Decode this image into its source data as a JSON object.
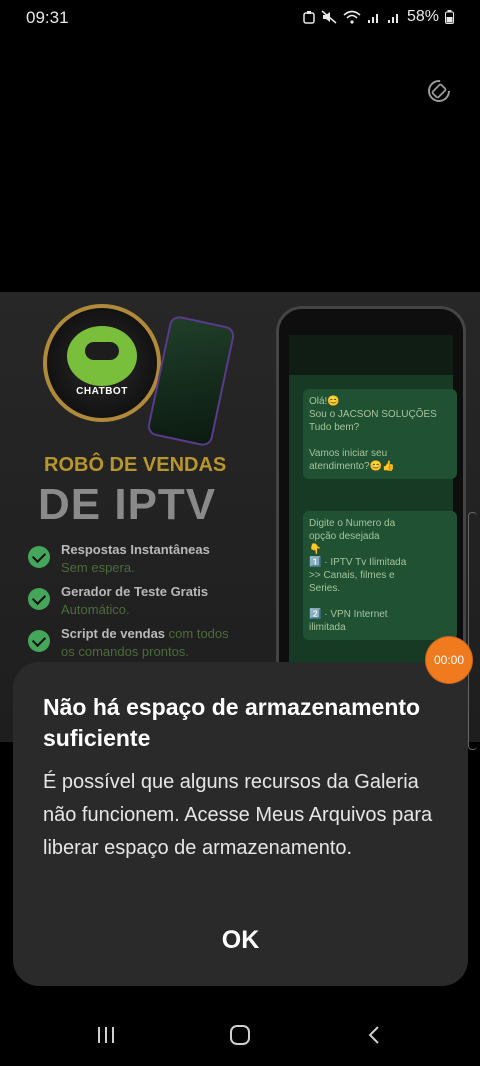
{
  "status_bar": {
    "time": "09:31",
    "battery": "58%",
    "icons": [
      "dnd-icon",
      "mute-icon",
      "wifi-icon",
      "signal-icon",
      "signal-icon",
      "battery-icon"
    ]
  },
  "gallery_image": {
    "logo_text": "CHATBOT",
    "promo_title": "ROBÔ DE VENDAS",
    "promo_big": "DE IPTV",
    "features": [
      {
        "title": "Respostas Instantâneas",
        "subtitle": "Sem espera."
      },
      {
        "title": "Gerador de Teste Gratis",
        "subtitle": "Automático."
      },
      {
        "title": "Script de vendas",
        "title_rest": " com todos",
        "subtitle": "os comandos prontos."
      }
    ],
    "phone_chat": {
      "bubble1": [
        "Olá!😊",
        "Sou o JACSON SOLUÇÕES",
        "Tudo bem?",
        "",
        "Vamos iniciar seu",
        "atendimento?😊👍"
      ],
      "bubble2": [
        "Digite o Numero da",
        "opção desejada",
        "👇",
        "1️⃣ · IPTV Tv Ilimitada",
        "  >> Canais, filmes e",
        "Series.",
        "",
        "2️⃣ · VPN Internet",
        "ilimitada"
      ]
    }
  },
  "timer_label": "00:00",
  "dialog": {
    "title": "Não há espaço de armazenamento suficiente",
    "body": "É possível que alguns recursos da Galeria não funcionem. Acesse Meus Arquivos para liberar espaço de armazenamento.",
    "ok_label": "OK"
  },
  "colors": {
    "dialog_bg": "#2a2a2a",
    "accent_orange": "#f07a1e",
    "promo_gold": "#b8962e",
    "check_green": "#43a65a"
  }
}
